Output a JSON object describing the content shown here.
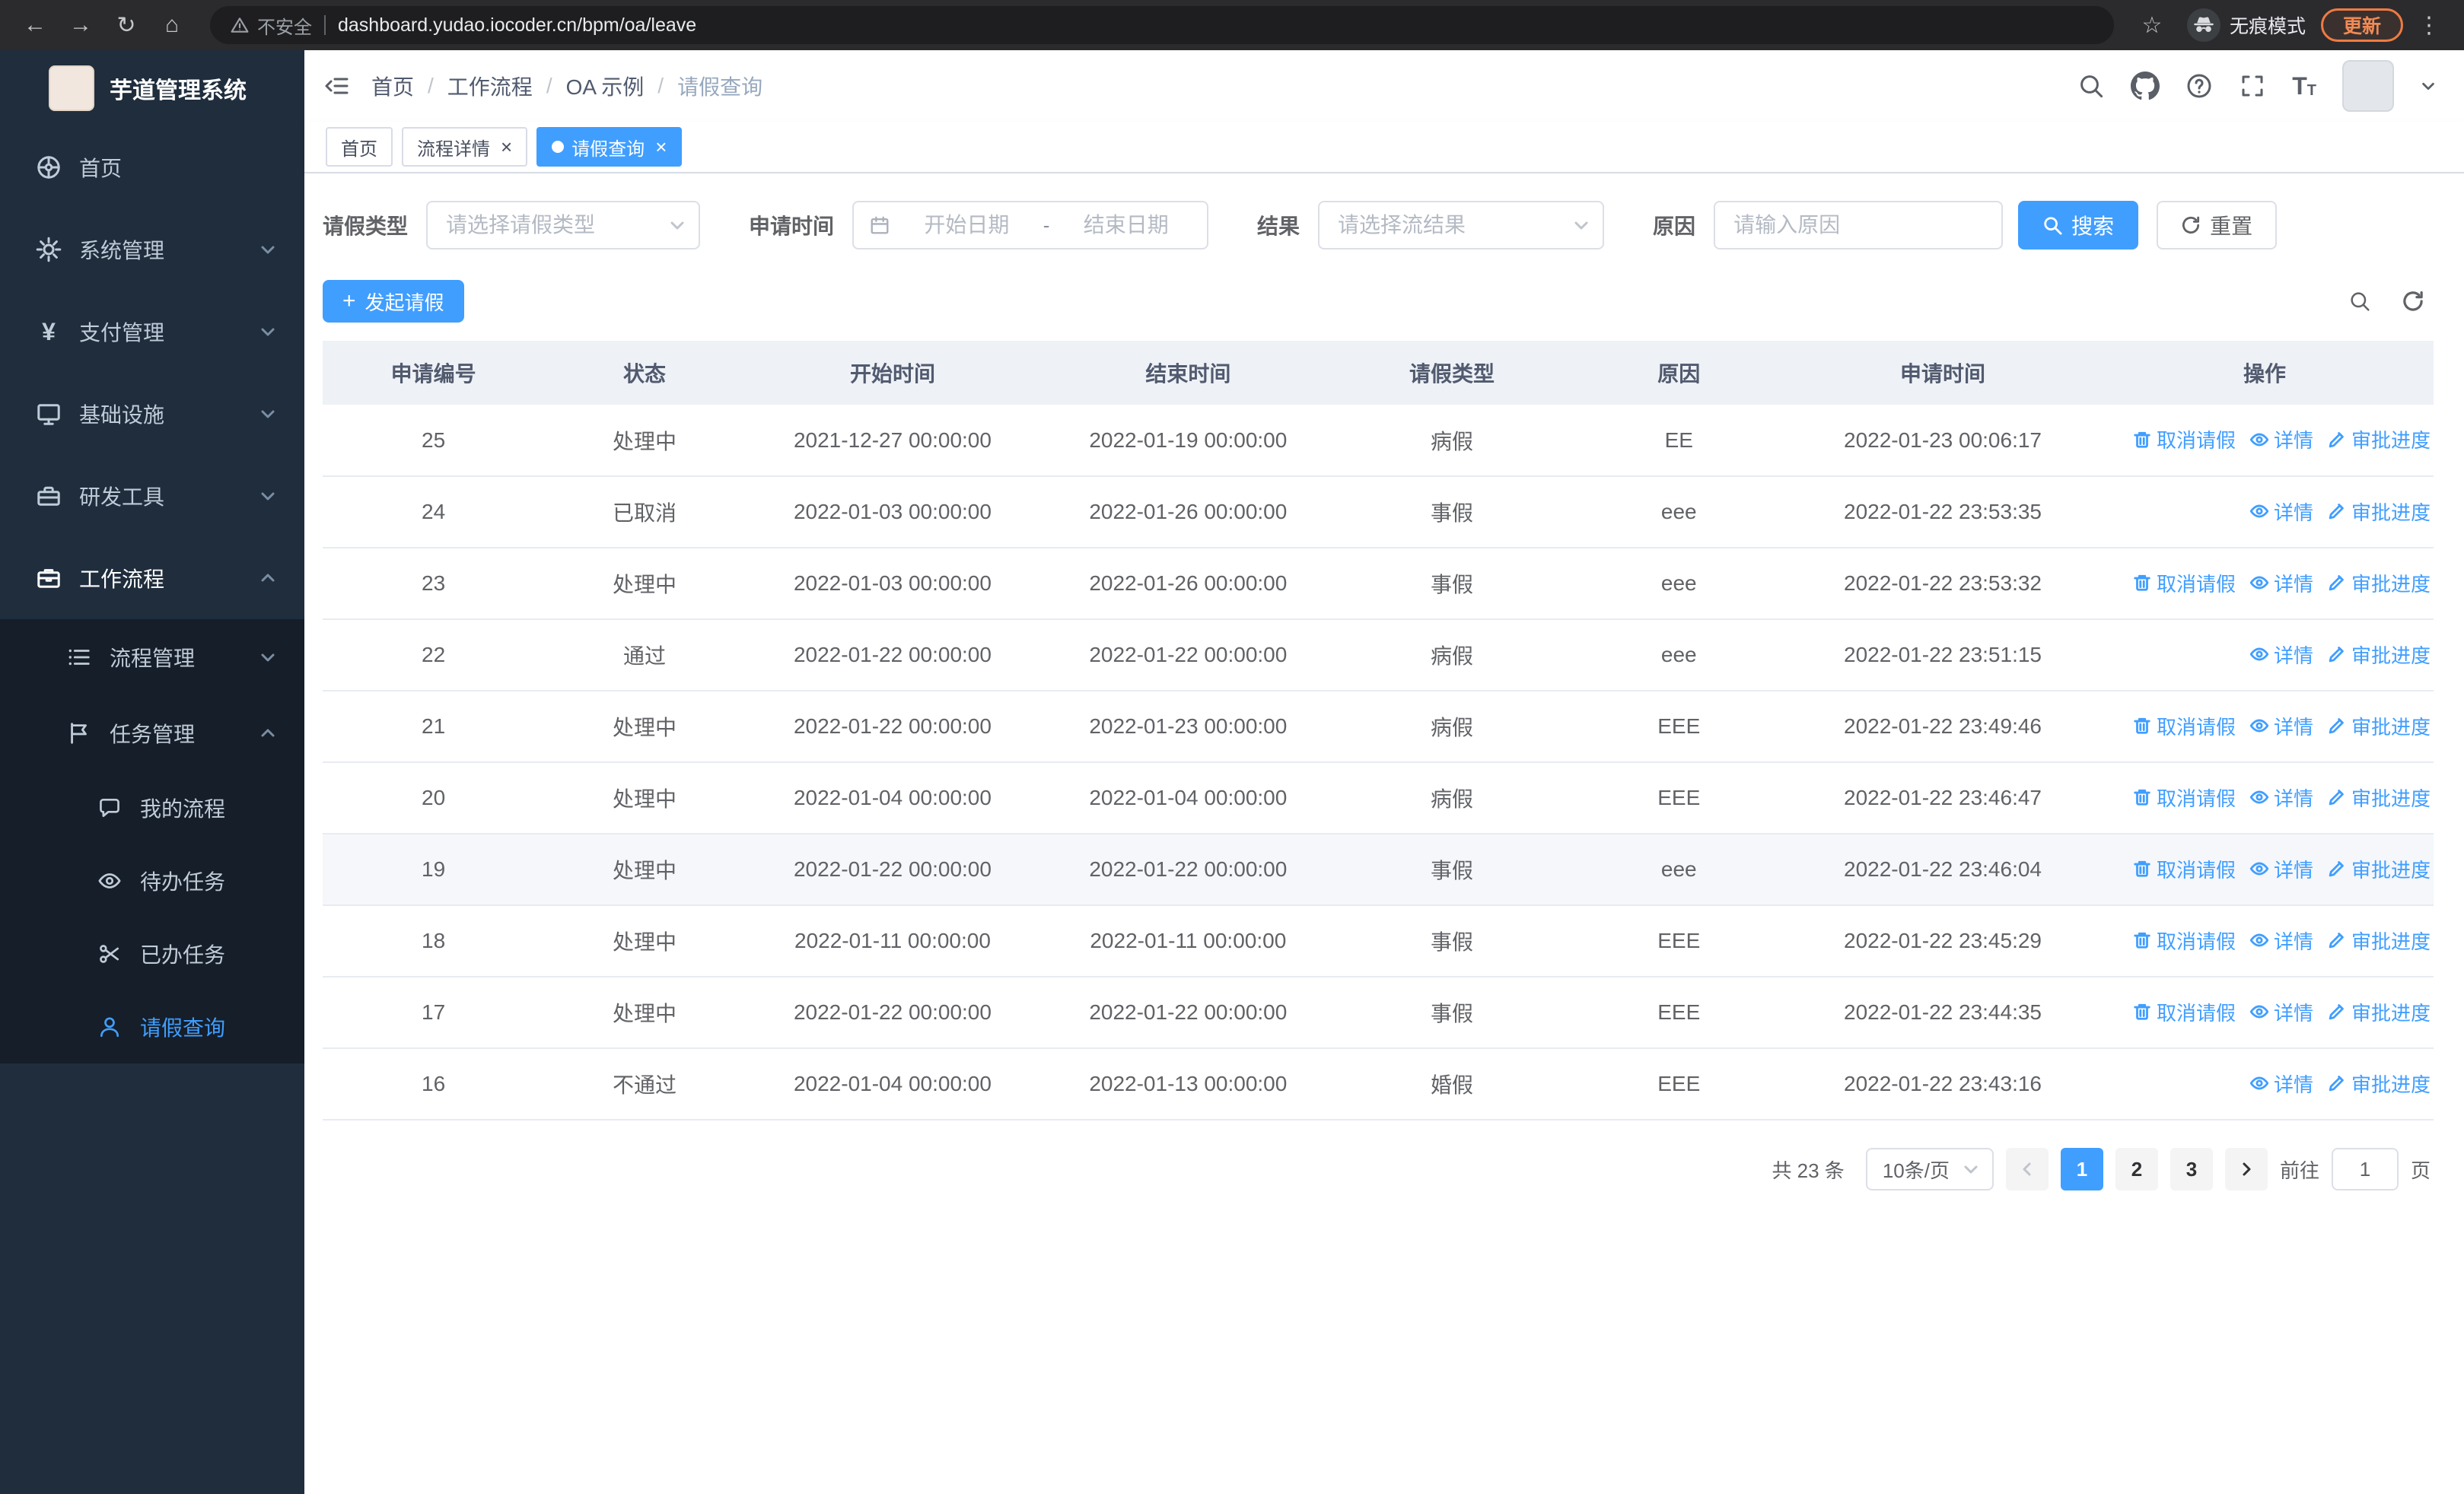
{
  "browser": {
    "warning": "不安全",
    "url": "dashboard.yudao.iocoder.cn/bpm/oa/leave",
    "incognito": "无痕模式",
    "update": "更新"
  },
  "icons": {
    "back": "←",
    "forward": "→",
    "reload": "↻",
    "home": "⌂",
    "star": "☆",
    "menu": "⋮",
    "plus": "+",
    "close": "×",
    "yen": "¥",
    "font_size_large": "T",
    "font_size_small": "T"
  },
  "sidebar": {
    "title": "芋道管理系统",
    "menu": [
      {
        "label": "首页"
      },
      {
        "label": "系统管理"
      },
      {
        "label": "支付管理"
      },
      {
        "label": "基础设施"
      },
      {
        "label": "研发工具"
      },
      {
        "label": "工作流程"
      }
    ],
    "workflow_children": [
      {
        "label": "流程管理"
      },
      {
        "label": "任务管理"
      }
    ],
    "task_children": [
      {
        "label": "我的流程"
      },
      {
        "label": "待办任务"
      },
      {
        "label": "已办任务"
      },
      {
        "label": "请假查询"
      }
    ]
  },
  "header": {
    "breadcrumb": [
      "首页",
      "工作流程",
      "OA 示例",
      "请假查询"
    ],
    "separator": "/"
  },
  "tabs": [
    {
      "label": "首页"
    },
    {
      "label": "流程详情"
    },
    {
      "label": "请假查询"
    }
  ],
  "filters": {
    "leave_type_label": "请假类型",
    "leave_type_placeholder": "请选择请假类型",
    "apply_time_label": "申请时间",
    "start_placeholder": "开始日期",
    "range_separator": "-",
    "end_placeholder": "结束日期",
    "result_label": "结果",
    "result_placeholder": "请选择流结果",
    "reason_label": "原因",
    "reason_placeholder": "请输入原因",
    "search_label": "搜索",
    "reset_label": "重置"
  },
  "toolbar": {
    "create_label": "发起请假"
  },
  "table": {
    "columns": [
      "申请编号",
      "状态",
      "开始时间",
      "结束时间",
      "请假类型",
      "原因",
      "申请时间",
      "操作"
    ],
    "action_labels": {
      "cancel": "取消请假",
      "detail": "详情",
      "progress": "审批进度"
    },
    "rows": [
      {
        "id": "25",
        "status": "处理中",
        "start": "2021-12-27 00:00:00",
        "end": "2022-01-19 00:00:00",
        "type": "病假",
        "reason": "EE",
        "applied": "2022-01-23 00:06:17",
        "actions": [
          "cancel",
          "detail",
          "progress"
        ],
        "highlighted": false
      },
      {
        "id": "24",
        "status": "已取消",
        "start": "2022-01-03 00:00:00",
        "end": "2022-01-26 00:00:00",
        "type": "事假",
        "reason": "eee",
        "applied": "2022-01-22 23:53:35",
        "actions": [
          "detail",
          "progress"
        ],
        "highlighted": false
      },
      {
        "id": "23",
        "status": "处理中",
        "start": "2022-01-03 00:00:00",
        "end": "2022-01-26 00:00:00",
        "type": "事假",
        "reason": "eee",
        "applied": "2022-01-22 23:53:32",
        "actions": [
          "cancel",
          "detail",
          "progress"
        ],
        "highlighted": false
      },
      {
        "id": "22",
        "status": "通过",
        "start": "2022-01-22 00:00:00",
        "end": "2022-01-22 00:00:00",
        "type": "病假",
        "reason": "eee",
        "applied": "2022-01-22 23:51:15",
        "actions": [
          "detail",
          "progress"
        ],
        "highlighted": false
      },
      {
        "id": "21",
        "status": "处理中",
        "start": "2022-01-22 00:00:00",
        "end": "2022-01-23 00:00:00",
        "type": "病假",
        "reason": "EEE",
        "applied": "2022-01-22 23:49:46",
        "actions": [
          "cancel",
          "detail",
          "progress"
        ],
        "highlighted": false
      },
      {
        "id": "20",
        "status": "处理中",
        "start": "2022-01-04 00:00:00",
        "end": "2022-01-04 00:00:00",
        "type": "病假",
        "reason": "EEE",
        "applied": "2022-01-22 23:46:47",
        "actions": [
          "cancel",
          "detail",
          "progress"
        ],
        "highlighted": false
      },
      {
        "id": "19",
        "status": "处理中",
        "start": "2022-01-22 00:00:00",
        "end": "2022-01-22 00:00:00",
        "type": "事假",
        "reason": "eee",
        "applied": "2022-01-22 23:46:04",
        "actions": [
          "cancel",
          "detail",
          "progress"
        ],
        "highlighted": true
      },
      {
        "id": "18",
        "status": "处理中",
        "start": "2022-01-11 00:00:00",
        "end": "2022-01-11 00:00:00",
        "type": "事假",
        "reason": "EEE",
        "applied": "2022-01-22 23:45:29",
        "actions": [
          "cancel",
          "detail",
          "progress"
        ],
        "highlighted": false
      },
      {
        "id": "17",
        "status": "处理中",
        "start": "2022-01-22 00:00:00",
        "end": "2022-01-22 00:00:00",
        "type": "事假",
        "reason": "EEE",
        "applied": "2022-01-22 23:44:35",
        "actions": [
          "cancel",
          "detail",
          "progress"
        ],
        "highlighted": false
      },
      {
        "id": "16",
        "status": "不通过",
        "start": "2022-01-04 00:00:00",
        "end": "2022-01-13 00:00:00",
        "type": "婚假",
        "reason": "EEE",
        "applied": "2022-01-22 23:43:16",
        "actions": [
          "detail",
          "progress"
        ],
        "highlighted": false
      }
    ]
  },
  "pagination": {
    "total": "共 23 条",
    "page_size": "10条/页",
    "pages": [
      "1",
      "2",
      "3"
    ],
    "active_page": "1",
    "goto_label": "前往",
    "goto_value": "1",
    "unit_label": "页"
  }
}
